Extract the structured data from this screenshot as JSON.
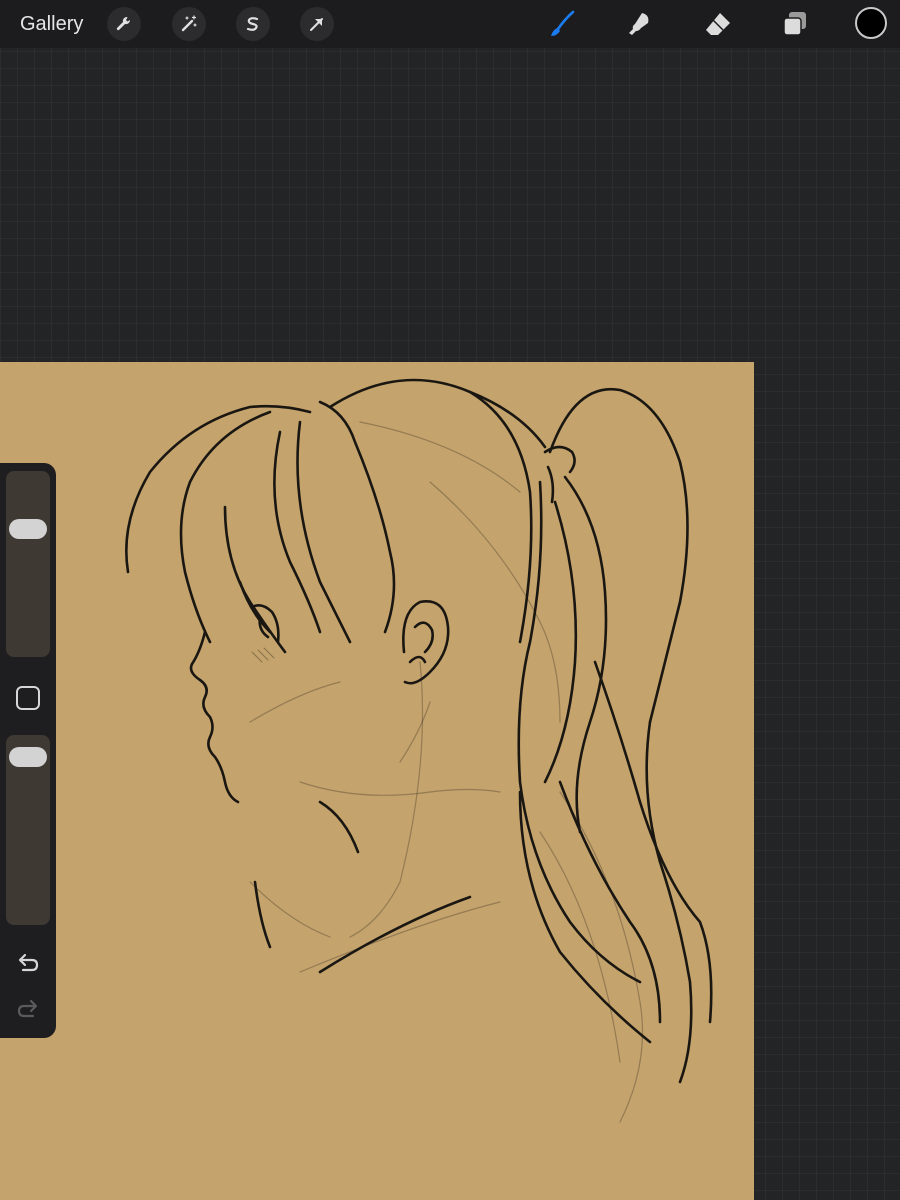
{
  "toolbar": {
    "gallery_label": "Gallery",
    "left_tools": [
      {
        "icon": "wrench-icon",
        "name": "actions"
      },
      {
        "icon": "magic-wand-icon",
        "name": "adjustments"
      },
      {
        "icon": "selection-s-icon",
        "name": "selection"
      },
      {
        "icon": "arrow-cursor-icon",
        "name": "transform"
      }
    ],
    "right_tools": [
      {
        "icon": "brush-icon",
        "name": "paint",
        "active": true
      },
      {
        "icon": "smudge-icon",
        "name": "smudge",
        "active": false
      },
      {
        "icon": "eraser-icon",
        "name": "erase",
        "active": false
      },
      {
        "icon": "layers-icon",
        "name": "layers",
        "active": false
      }
    ],
    "current_color": "#000000",
    "active_tool_color": "#1b7cf2"
  },
  "canvas": {
    "background_color": "#c4a36c",
    "stroke_color": "#1a1712",
    "content": "sketch-of-girl-with-ponytail-profile"
  },
  "sidebar": {
    "brush_size_level": 0.72,
    "opacity_level": 0.95
  },
  "colors": {
    "toolbar_bg": "#1c1c1e",
    "workspace_bg": "#232426",
    "sidebar_bg": "#1e1e20"
  }
}
